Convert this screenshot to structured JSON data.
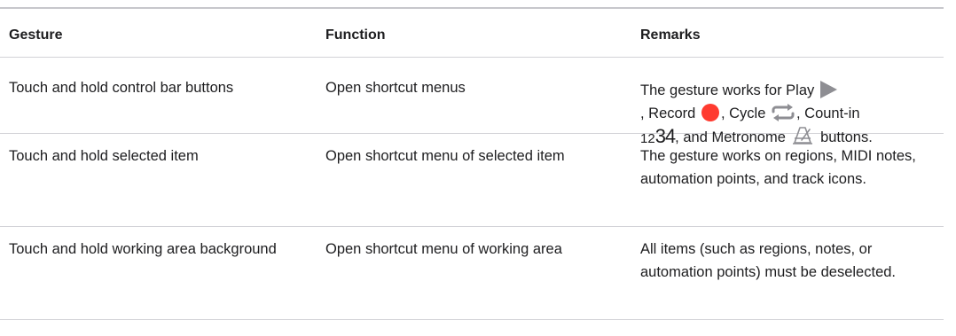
{
  "table": {
    "headers": [
      "Gesture",
      "Function",
      "Remarks"
    ],
    "rows": [
      {
        "gesture": "Touch and hold control bar buttons",
        "function": "Open shortcut menus",
        "remarks": {
          "part1": "The gesture works for Play",
          "part2": ", Record",
          "part3": ", Cycle",
          "part4": ", Count-in",
          "count_in_small": "12",
          "count_in_large": "34",
          "part5": ", and Metronome",
          "part6": " buttons."
        }
      },
      {
        "gesture": "Touch and hold selected item",
        "function": "Open shortcut menu of selected item",
        "remarks": "The gesture works on regions, MIDI notes, automation points, and track icons."
      },
      {
        "gesture": "Touch and hold working area background",
        "function": "Open shortcut menu of working area",
        "remarks": "All items (such as regions, notes, or automation points) must be deselected."
      }
    ]
  },
  "icons": {
    "play": "play-icon",
    "record": "record-icon",
    "cycle": "cycle-icon",
    "metronome": "metronome-icon"
  },
  "colors": {
    "record": "#ff3b30",
    "icon_gray": "#8e8e93"
  }
}
